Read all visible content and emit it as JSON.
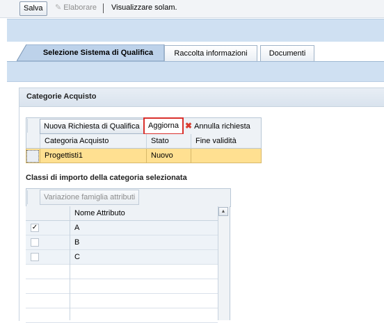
{
  "toolbar": {
    "save_label": "Salva",
    "edit_label": "Elaborare",
    "view_label": "Visualizzare solam."
  },
  "tabs": [
    {
      "label": "Selezione Sistema di Qualifica",
      "active": true
    },
    {
      "label": "Raccolta informazioni",
      "active": false
    },
    {
      "label": "Documenti",
      "active": false
    }
  ],
  "panel": {
    "title": "Categorie Acquisto"
  },
  "table1": {
    "buttons": {
      "new_request": "Nuova Richiesta di Qualifica",
      "refresh": "Aggiorna",
      "cancel_request": "Annulla richiesta"
    },
    "columns": [
      "Categoria Acquisto",
      "Stato",
      "Fine validità"
    ],
    "rows": [
      {
        "category": "Progettisti1",
        "status": "Nuovo",
        "end": ""
      }
    ]
  },
  "section2": {
    "title": "Classi di importo della categoria selezionata",
    "variant_button": "Variazione famiglia attributi",
    "column": "Nome Attributo",
    "rows": [
      {
        "name": "A",
        "checked": true
      },
      {
        "name": "B",
        "checked": false
      },
      {
        "name": "C",
        "checked": false
      }
    ]
  },
  "icons": {
    "edit": "pencil-icon",
    "cancel": "x-icon",
    "scroll_up": "triangle-up-icon"
  },
  "colors": {
    "band": "#cfe0f2",
    "selected_row": "#ffe091",
    "highlight_border": "#d9302c"
  }
}
